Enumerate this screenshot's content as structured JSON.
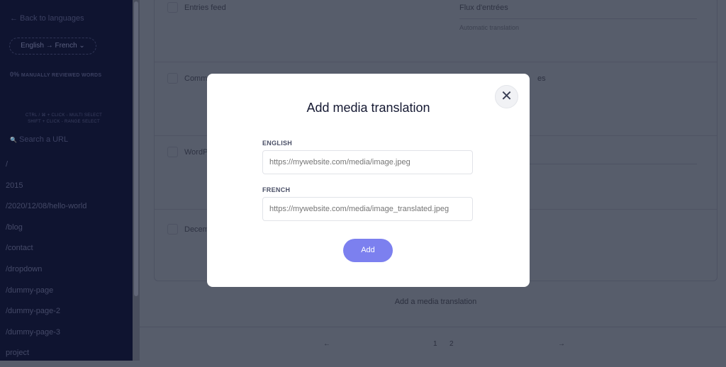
{
  "sidebar": {
    "back": "← Back to languages",
    "lang_pair": "English → French ⌄",
    "reviewed_pct": "0%",
    "reviewed_label": "MANUALLY REVIEWED WORDS",
    "hint1": "CTRL / ⌘ + CLICK - MULTI SELECT",
    "hint2": "SHIFT + CLICK - RANGE SELECT",
    "search_placeholder": "Search a URL",
    "search_icon": "🔍",
    "urls": [
      "/",
      "2015",
      "/2020/12/08/hello-world",
      "/blog",
      "/contact",
      "/dropdown",
      "/dummy-page",
      "/dummy-page-2",
      "/dummy-page-3",
      "project"
    ]
  },
  "main": {
    "rows": [
      {
        "source": "Entries feed",
        "target": "Flux d'entrées",
        "status": "Automatic translation"
      },
      {
        "source": "Comm",
        "target": "es"
      },
      {
        "source": "WordP"
      },
      {
        "source": "Decem"
      }
    ],
    "add_media": "Add a media translation",
    "pagination": {
      "prev": "←",
      "pages": [
        "1",
        "2"
      ],
      "next": "→"
    }
  },
  "modal": {
    "title": "Add media translation",
    "close": "✕",
    "english_label": "ENGLISH",
    "english_placeholder": "https://mywebsite.com/media/image.jpeg",
    "french_label": "FRENCH",
    "french_placeholder": "https://mywebsite.com/media/image_translated.jpeg",
    "add": "Add"
  }
}
